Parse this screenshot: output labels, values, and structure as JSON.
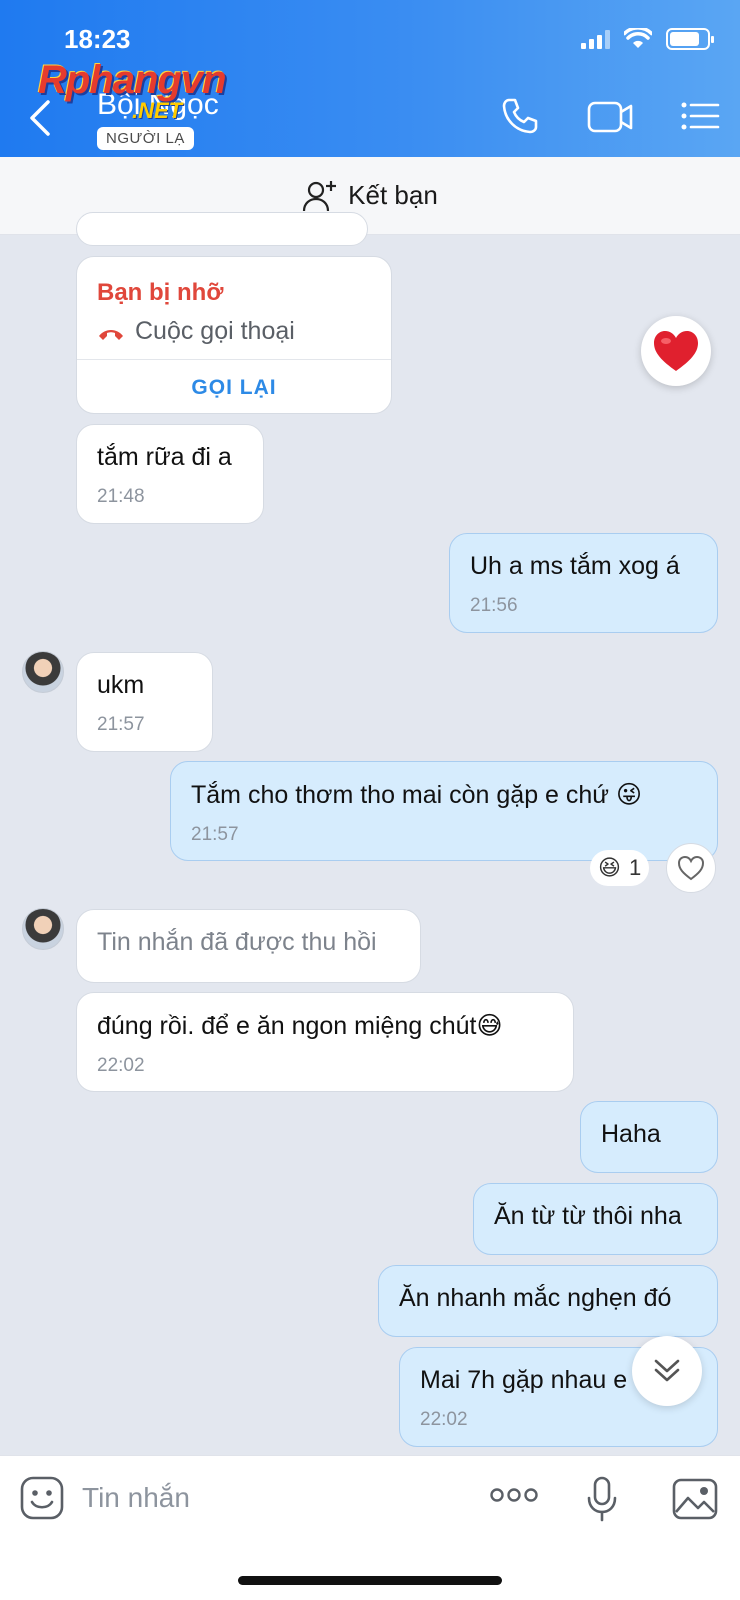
{
  "status_bar": {
    "time": "18:23"
  },
  "watermark": {
    "brand": "Rphangvn",
    "suffix": ".NET"
  },
  "header": {
    "contact_name": "Bội Ngọc",
    "badge": "NGƯỜI LẠ"
  },
  "add_friend": {
    "label": "Kết bạn"
  },
  "messages": {
    "partial": {},
    "missed_call": {
      "title": "Bạn bị nhỡ",
      "subtitle": "Cuộc gọi thoại",
      "action": "GỌI LẠI"
    },
    "m1": {
      "text": "tắm rữa đi a",
      "time": "21:48"
    },
    "m2": {
      "text": "Uh a ms tắm xog á",
      "time": "21:56"
    },
    "m3": {
      "text": "ukm",
      "time": "21:57"
    },
    "m4": {
      "text": "Tắm cho thơm tho mai còn gặp e chứ 😜",
      "time": "21:57",
      "reaction_count": "1"
    },
    "m5": {
      "text": "Tin nhắn đã được thu hồi"
    },
    "m6": {
      "text": "đúng rồi. để e ăn ngon miệng chút😅",
      "time": "22:02"
    },
    "m7": {
      "text": "Haha"
    },
    "m8": {
      "text": "Ăn từ từ thôi nha"
    },
    "m9": {
      "text": "Ăn nhanh mắc nghẹn đó"
    },
    "m10": {
      "text": "Mai 7h gặp nhau e",
      "time": "22:02"
    }
  },
  "input": {
    "placeholder": "Tin nhắn"
  },
  "colors": {
    "header": "#1f7af0",
    "outgoing_bubble": "#d6ecfd",
    "missed_title": "#e0473b",
    "link": "#2d8ae6"
  },
  "icons": [
    "back-icon",
    "phone-icon",
    "video-icon",
    "menu-icon",
    "add-friend-icon",
    "missed-call-icon",
    "heart-icon",
    "scroll-down-icon",
    "sticker-icon",
    "more-icon",
    "mic-icon",
    "image-icon"
  ]
}
